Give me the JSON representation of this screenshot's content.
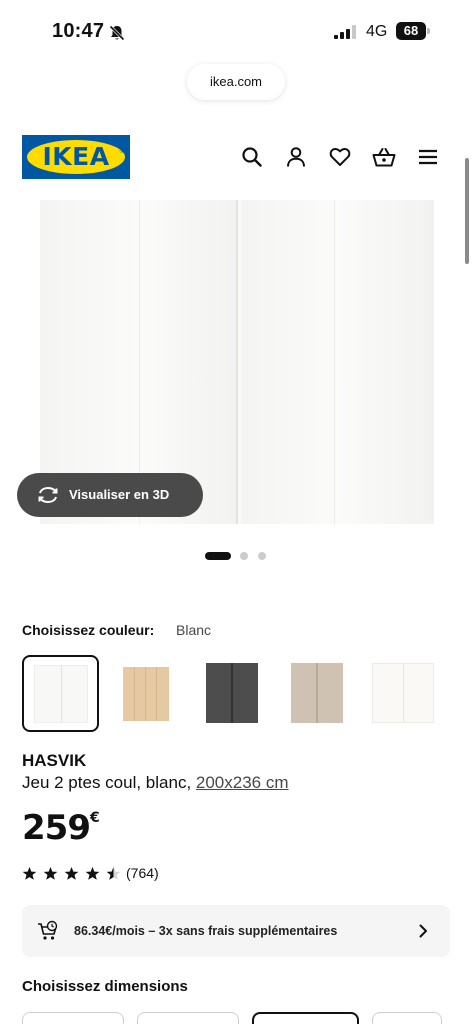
{
  "status_bar": {
    "time": "10:47",
    "network": "4G",
    "battery": "68"
  },
  "browser": {
    "url": "ikea.com"
  },
  "header": {
    "logo_text": "IKEA",
    "logo_colors": {
      "blue": "#0058a3",
      "yellow": "#ffdb00"
    },
    "icons": [
      "search-icon",
      "account-icon",
      "heart-icon",
      "shopping-bag-icon",
      "menu-icon"
    ]
  },
  "gallery": {
    "view_3d_label": "Visualiser en 3D",
    "dots": {
      "count": 3,
      "active_index": 0
    }
  },
  "color_chooser": {
    "label": "Choisissez couleur:",
    "selected": "Blanc",
    "swatches": [
      {
        "name": "Blanc",
        "color": "#f8f8f6",
        "selected": true
      },
      {
        "name": "effet chêne",
        "color": "#e6c9a2",
        "selected": false
      },
      {
        "name": "gris foncé",
        "color": "#4d4d4d",
        "selected": false
      },
      {
        "name": "beige",
        "color": "#cfc2b3",
        "selected": false
      },
      {
        "name": "blanc brillant",
        "color": "#faf9f5",
        "selected": false
      }
    ]
  },
  "product": {
    "name": "HASVIK",
    "description": "Jeu 2 ptes coul, blanc, ",
    "size": "200x236 cm",
    "price": "259",
    "currency": "€",
    "rating_stars": 4.5,
    "rating_max": 5,
    "review_count": "(764)"
  },
  "financing": {
    "text": "86.34€/mois – 3x sans frais supplémentaires"
  },
  "dimensions": {
    "label": "Choisissez dimensions",
    "options_visible": 4,
    "selected_index": 2
  }
}
